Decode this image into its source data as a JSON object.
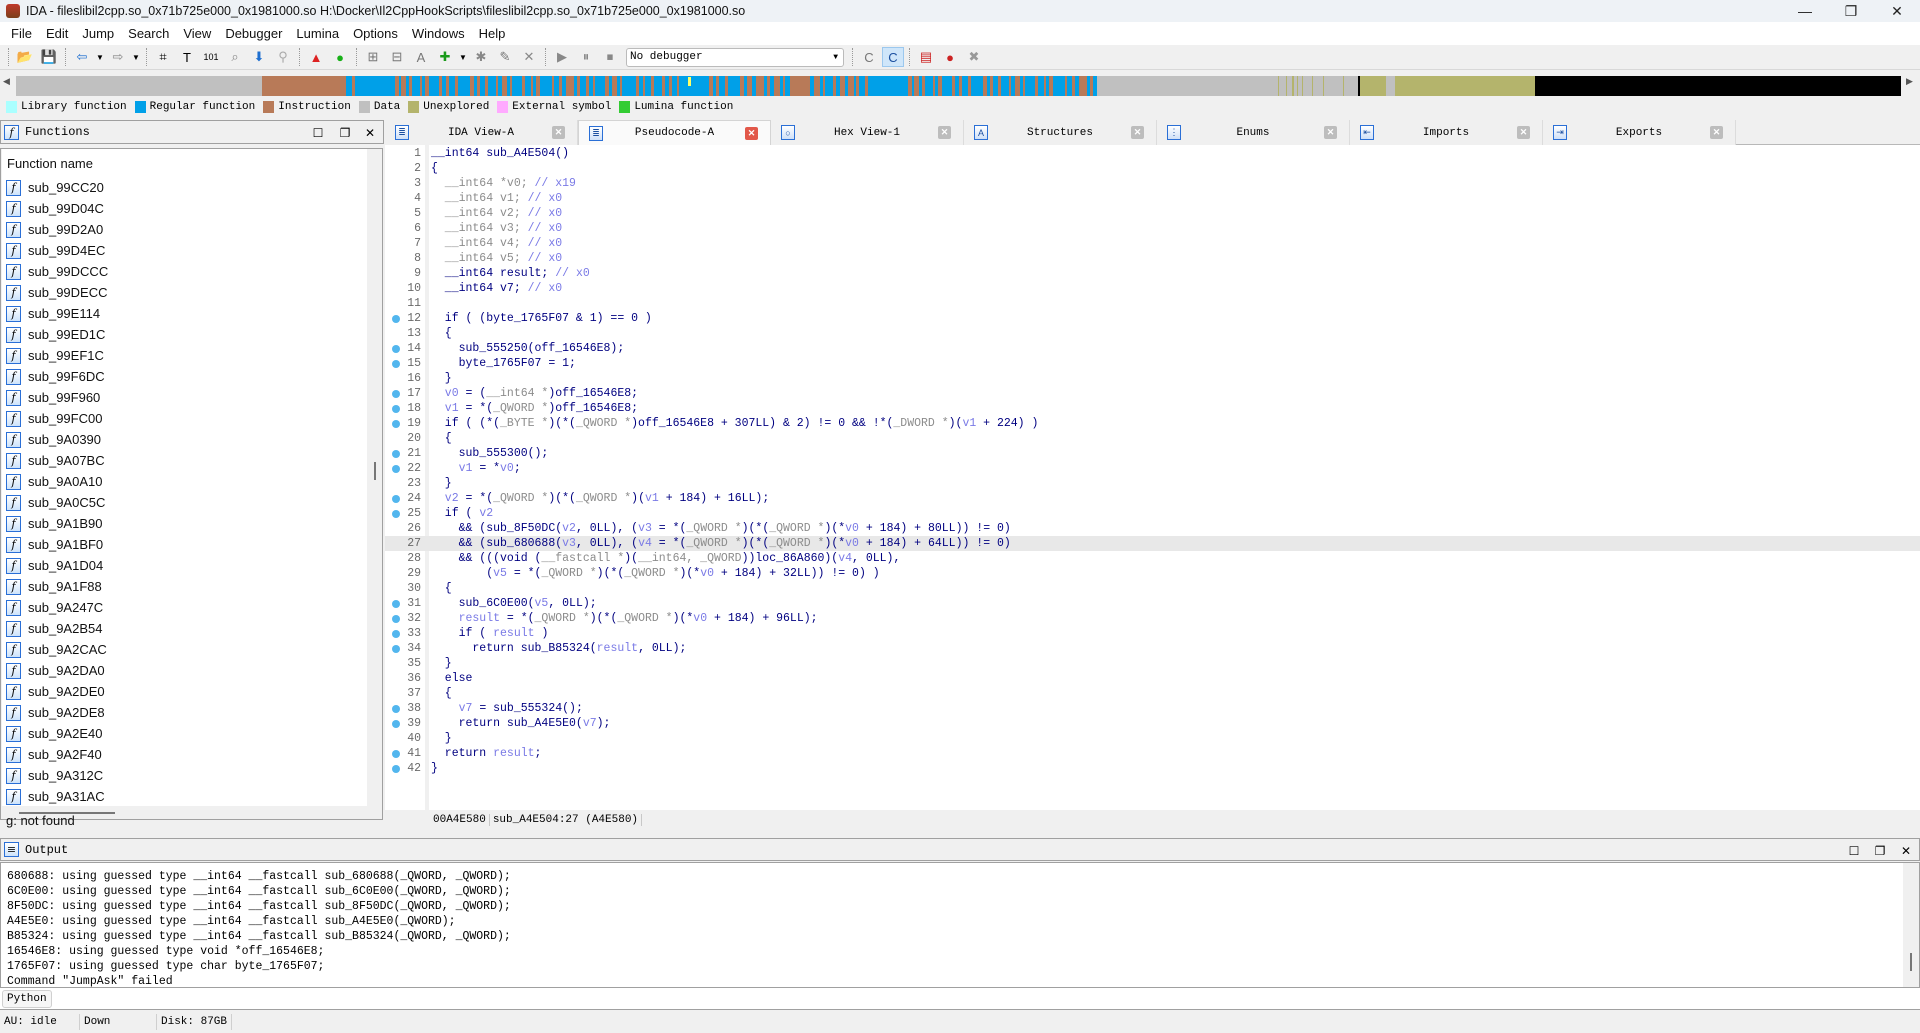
{
  "window": {
    "title": "IDA - fileslibil2cpp.so_0x71b725e000_0x1981000.so H:\\Docker\\Il2CppHookScripts\\fileslibil2cpp.so_0x71b725e000_0x1981000.so",
    "minimize": "—",
    "maximize": "❐",
    "close": "✕"
  },
  "menu": [
    "File",
    "Edit",
    "Jump",
    "Search",
    "View",
    "Debugger",
    "Lumina",
    "Options",
    "Windows",
    "Help"
  ],
  "toolbar": {
    "debugger_select": "No debugger",
    "dropdown_arrow": "▼"
  },
  "legend": [
    {
      "label": "Library function",
      "color": "#aaffff"
    },
    {
      "label": "Regular function",
      "color": "#00a0e8"
    },
    {
      "label": "Instruction",
      "color": "#b87a58"
    },
    {
      "label": "Data",
      "color": "#c0c0c0"
    },
    {
      "label": "Unexplored",
      "color": "#b4b46c"
    },
    {
      "label": "External symbol",
      "color": "#ffaaff"
    },
    {
      "label": "Lumina function",
      "color": "#33cc33"
    }
  ],
  "functions_panel": {
    "title": "Functions",
    "column_header": "Function name",
    "items": [
      "sub_99CC20",
      "sub_99D04C",
      "sub_99D2A0",
      "sub_99D4EC",
      "sub_99DCCC",
      "sub_99DECC",
      "sub_99E114",
      "sub_99ED1C",
      "sub_99EF1C",
      "sub_99F6DC",
      "sub_99F960",
      "sub_99FC00",
      "sub_9A0390",
      "sub_9A07BC",
      "sub_9A0A10",
      "sub_9A0C5C",
      "sub_9A1B90",
      "sub_9A1BF0",
      "sub_9A1D04",
      "sub_9A1F88",
      "sub_9A247C",
      "sub_9A2B54",
      "sub_9A2CAC",
      "sub_9A2DA0",
      "sub_9A2DE0",
      "sub_9A2DE8",
      "sub_9A2E40",
      "sub_9A2F40",
      "sub_9A312C",
      "sub_9A31AC"
    ],
    "status": "g: not found"
  },
  "tabs": [
    {
      "label": "IDA View-A",
      "icon": "listing-icon",
      "active": false
    },
    {
      "label": "Pseudocode-A",
      "icon": "listing-icon",
      "active": true
    },
    {
      "label": "Hex View-1",
      "icon": "hex-icon",
      "active": false
    },
    {
      "label": "Structures",
      "icon": "struct-icon",
      "active": false
    },
    {
      "label": "Enums",
      "icon": "enum-icon",
      "active": false
    },
    {
      "label": "Imports",
      "icon": "imports-icon",
      "active": false
    },
    {
      "label": "Exports",
      "icon": "exports-icon",
      "active": false
    }
  ],
  "pseudocode": {
    "highlighted_line": 27,
    "breakpoint_lines": [
      12,
      14,
      15,
      17,
      18,
      19,
      21,
      22,
      24,
      25,
      31,
      32,
      33,
      34,
      38,
      39,
      41,
      42
    ],
    "lines": [
      [
        [
          "n",
          "__int64 sub_A4E504()"
        ]
      ],
      [
        [
          "n",
          "{"
        ]
      ],
      [
        [
          "g",
          "  __int64 *v0; "
        ],
        [
          "c",
          "// x19"
        ]
      ],
      [
        [
          "g",
          "  __int64 v1; "
        ],
        [
          "c",
          "// x0"
        ]
      ],
      [
        [
          "g",
          "  __int64 v2; "
        ],
        [
          "c",
          "// x0"
        ]
      ],
      [
        [
          "g",
          "  __int64 v3; "
        ],
        [
          "c",
          "// x0"
        ]
      ],
      [
        [
          "g",
          "  __int64 v4; "
        ],
        [
          "c",
          "// x0"
        ]
      ],
      [
        [
          "g",
          "  __int64 v5; "
        ],
        [
          "c",
          "// x0"
        ]
      ],
      [
        [
          "n",
          "  __int64 result; "
        ],
        [
          "c",
          "// x0"
        ]
      ],
      [
        [
          "n",
          "  __int64 v7; "
        ],
        [
          "c",
          "// x0"
        ]
      ],
      [
        [
          "n",
          ""
        ]
      ],
      [
        [
          "n",
          "  if ( (byte_1765F07 & 1) == 0 )"
        ]
      ],
      [
        [
          "n",
          "  {"
        ]
      ],
      [
        [
          "n",
          "    sub_555250(off_16546E8);"
        ]
      ],
      [
        [
          "n",
          "    byte_1765F07 = 1;"
        ]
      ],
      [
        [
          "n",
          "  }"
        ]
      ],
      [
        [
          "v",
          "  v0"
        ],
        [
          "n",
          " = ("
        ],
        [
          "g",
          "__int64 *"
        ],
        [
          "n",
          ")off_16546E8;"
        ]
      ],
      [
        [
          "v",
          "  v1"
        ],
        [
          "n",
          " = *("
        ],
        [
          "g",
          "_QWORD *"
        ],
        [
          "n",
          ")off_16546E8;"
        ]
      ],
      [
        [
          "n",
          "  if ( (*("
        ],
        [
          "g",
          "_BYTE *"
        ],
        [
          "n",
          ")(*("
        ],
        [
          "g",
          "_QWORD *"
        ],
        [
          "n",
          ")off_16546E8 + 307LL) & 2) != 0 && !*("
        ],
        [
          "g",
          "_DWORD *"
        ],
        [
          "n",
          ")("
        ],
        [
          "v",
          "v1"
        ],
        [
          "n",
          " + 224) )"
        ]
      ],
      [
        [
          "n",
          "  {"
        ]
      ],
      [
        [
          "n",
          "    sub_555300();"
        ]
      ],
      [
        [
          "v",
          "    v1"
        ],
        [
          "n",
          " = *"
        ],
        [
          "v",
          "v0"
        ],
        [
          "n",
          ";"
        ]
      ],
      [
        [
          "n",
          "  }"
        ]
      ],
      [
        [
          "v",
          "  v2"
        ],
        [
          "n",
          " = *("
        ],
        [
          "g",
          "_QWORD *"
        ],
        [
          "n",
          ")(*("
        ],
        [
          "g",
          "_QWORD *"
        ],
        [
          "n",
          ")("
        ],
        [
          "v",
          "v1"
        ],
        [
          "n",
          " + 184) + 16LL);"
        ]
      ],
      [
        [
          "n",
          "  if ( "
        ],
        [
          "v",
          "v2"
        ]
      ],
      [
        [
          "n",
          "    && (sub_8F50DC("
        ],
        [
          "v",
          "v2"
        ],
        [
          "n",
          ", 0LL), ("
        ],
        [
          "v",
          "v3"
        ],
        [
          "n",
          " = *("
        ],
        [
          "g",
          "_QWORD *"
        ],
        [
          "n",
          ")(*("
        ],
        [
          "g",
          "_QWORD *"
        ],
        [
          "n",
          ")(*"
        ],
        [
          "v",
          "v0"
        ],
        [
          "n",
          " + 184) + 80LL)) != 0)"
        ]
      ],
      [
        [
          "n",
          "    && (sub_680688("
        ],
        [
          "v",
          "v3"
        ],
        [
          "n",
          ", 0LL), ("
        ],
        [
          "v",
          "v4"
        ],
        [
          "n",
          " = *("
        ],
        [
          "g",
          "_QWORD *"
        ],
        [
          "n",
          ")(*("
        ],
        [
          "g",
          "_QWORD *"
        ],
        [
          "n",
          ")(*"
        ],
        [
          "v",
          "v0"
        ],
        [
          "n",
          " + 184) + 64LL)) != 0)"
        ]
      ],
      [
        [
          "n",
          "    && (((void ("
        ],
        [
          "g",
          "__fastcall *"
        ],
        [
          "n",
          ")("
        ],
        [
          "g",
          "__int64, _QWORD"
        ],
        [
          "n",
          "))loc_86A860)("
        ],
        [
          "v",
          "v4"
        ],
        [
          "n",
          ", 0LL),"
        ]
      ],
      [
        [
          "n",
          "        ("
        ],
        [
          "v",
          "v5"
        ],
        [
          "n",
          " = *("
        ],
        [
          "g",
          "_QWORD *"
        ],
        [
          "n",
          ")(*("
        ],
        [
          "g",
          "_QWORD *"
        ],
        [
          "n",
          ")(*"
        ],
        [
          "v",
          "v0"
        ],
        [
          "n",
          " + 184) + 32LL)) != 0) )"
        ]
      ],
      [
        [
          "n",
          "  {"
        ]
      ],
      [
        [
          "n",
          "    sub_6C0E00("
        ],
        [
          "v",
          "v5"
        ],
        [
          "n",
          ", 0LL);"
        ]
      ],
      [
        [
          "v",
          "    result"
        ],
        [
          "n",
          " = *("
        ],
        [
          "g",
          "_QWORD *"
        ],
        [
          "n",
          ")(*("
        ],
        [
          "g",
          "_QWORD *"
        ],
        [
          "n",
          ")(*"
        ],
        [
          "v",
          "v0"
        ],
        [
          "n",
          " + 184) + 96LL);"
        ]
      ],
      [
        [
          "n",
          "    if ( "
        ],
        [
          "v",
          "result"
        ],
        [
          "n",
          " )"
        ]
      ],
      [
        [
          "n",
          "      return sub_B85324("
        ],
        [
          "v",
          "result"
        ],
        [
          "n",
          ", 0LL);"
        ]
      ],
      [
        [
          "n",
          "  }"
        ]
      ],
      [
        [
          "n",
          "  else"
        ]
      ],
      [
        [
          "n",
          "  {"
        ]
      ],
      [
        [
          "v",
          "    v7"
        ],
        [
          "n",
          " = sub_555324();"
        ]
      ],
      [
        [
          "n",
          "    return sub_A4E5E0("
        ],
        [
          "v",
          "v7"
        ],
        [
          "n",
          ");"
        ]
      ],
      [
        [
          "n",
          "  }"
        ]
      ],
      [
        [
          "n",
          "  return "
        ],
        [
          "v",
          "result"
        ],
        [
          "n",
          ";"
        ]
      ],
      [
        [
          "n",
          "}"
        ]
      ]
    ],
    "status": {
      "address": "00A4E580",
      "location": "sub_A4E504:27 (A4E580)"
    }
  },
  "output_panel": {
    "title": "Output",
    "lines": [
      "680688: using guessed type __int64 __fastcall sub_680688(_QWORD, _QWORD);",
      "6C0E00: using guessed type __int64 __fastcall sub_6C0E00(_QWORD, _QWORD);",
      "8F50DC: using guessed type __int64 __fastcall sub_8F50DC(_QWORD, _QWORD);",
      "A4E5E0: using guessed type __int64 __fastcall sub_A4E5E0(_QWORD);",
      "B85324: using guessed type __int64 __fastcall sub_B85324(_QWORD, _QWORD);",
      "16546E8: using guessed type void *off_16546E8;",
      "1765F07: using guessed type char byte_1765F07;",
      "Command \"JumpAsk\" failed"
    ],
    "python_button": "Python",
    "python_input": ""
  },
  "statusbar": {
    "au": "AU:  idle",
    "direction": "Down",
    "disk": "Disk: 87GB"
  }
}
